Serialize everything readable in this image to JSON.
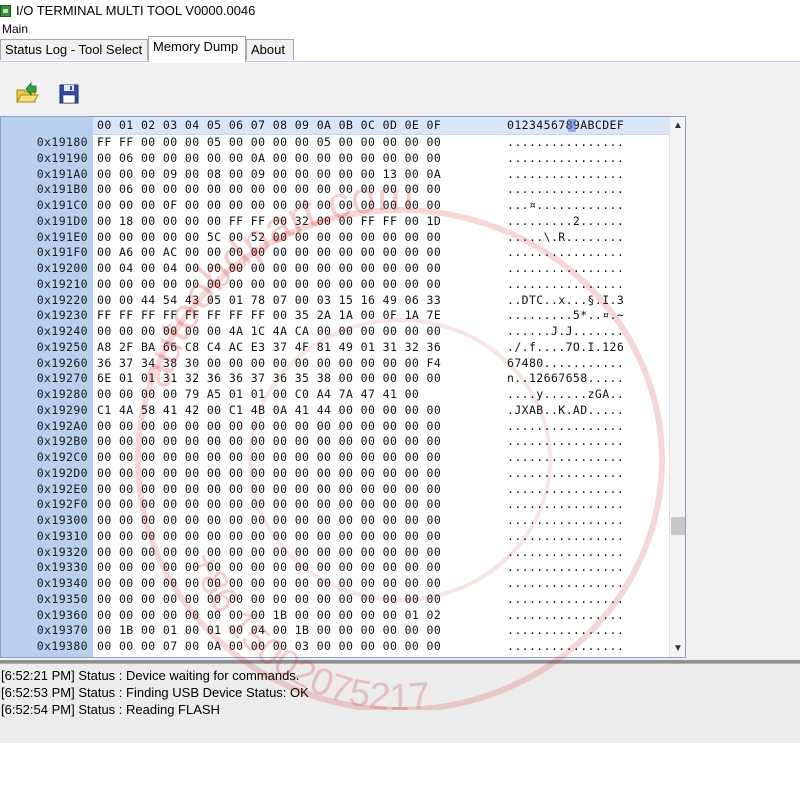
{
  "window": {
    "title": "I/O TERMINAL MULTI TOOL V0000.0046",
    "menu_main": "Main"
  },
  "tabs": [
    {
      "label": "Status Log - Tool Select",
      "active": false
    },
    {
      "label": "Memory Dump",
      "active": true
    },
    {
      "label": "About",
      "active": false
    }
  ],
  "toolbar": {
    "open_icon": "folder-open-icon",
    "save_icon": "floppy-save-icon"
  },
  "hex_view": {
    "header_hex": "00 01 02 03 04 05 06 07 08 09 0A 0B 0C 0D 0E 0F",
    "header_ascii": "0123456789ABCDEF",
    "rows": [
      {
        "offset": "0x19180",
        "hex": "FF FF 00 00 00 05 00 00 00 00 05 00 00 00 00 00",
        "ascii": "................"
      },
      {
        "offset": "0x19190",
        "hex": "00 06 00 00 00 00 00 0A 00 00 00 00 00 00 00 00",
        "ascii": "................"
      },
      {
        "offset": "0x191A0",
        "hex": "00 00 00 09 00 08 00 09 00 00 00 00 00 13 00 0A",
        "ascii": "................"
      },
      {
        "offset": "0x191B0",
        "hex": "00 06 00 00 00 00 00 00 00 00 00 00 00 00 00 00",
        "ascii": "................"
      },
      {
        "offset": "0x191C0",
        "hex": "00 00 00 0F 00 00 00 00 00 00 00 00 00 00 00 00",
        "ascii": "...¤............"
      },
      {
        "offset": "0x191D0",
        "hex": "00 18 00 00 00 00 FF FF 00 32 00 00 FF FF 00 1D",
        "ascii": ".........2......"
      },
      {
        "offset": "0x191E0",
        "hex": "00 00 00 00 00 5C 00 52 00 00 00 00 00 00 00 00",
        "ascii": ".....\\.R........"
      },
      {
        "offset": "0x191F0",
        "hex": "00 A6 00 AC 00 00 00 00 00 00 00 00 00 00 00 00",
        "ascii": "................"
      },
      {
        "offset": "0x19200",
        "hex": "00 04 00 04 00 00 00 00 00 00 00 00 00 00 00 00",
        "ascii": "................"
      },
      {
        "offset": "0x19210",
        "hex": "00 00 00 00 00 00 00 00 00 00 00 00 00 00 00 00",
        "ascii": "................"
      },
      {
        "offset": "0x19220",
        "hex": "00 00 44 54 43 05 01 78 07 00 03 15 16 49 06 33",
        "ascii": "..DTC..x...§.I.3"
      },
      {
        "offset": "0x19230",
        "hex": "FF FF FF FF FF FF FF FF 00 35 2A 1A 00 0F 1A 7E",
        "ascii": ".........5*..¤.~"
      },
      {
        "offset": "0x19240",
        "hex": "00 00 00 00 00 00 4A 1C 4A CA 00 00 00 00 00 00",
        "ascii": "......J.J......."
      },
      {
        "offset": "0x19250",
        "hex": "A8 2F BA 66 C8 C4 AC E3 37 4F 81 49 01 31 32 36",
        "ascii": "./.f....7O.I.126"
      },
      {
        "offset": "0x19260",
        "hex": "36 37 34 38 30 00 00 00 00 00 00 00 00 00 00 F4",
        "ascii": "67480..........."
      },
      {
        "offset": "0x19270",
        "hex": "6E 01 01 31 32 36 36 37 36 35 38 00 00 00 00 00",
        "ascii": "n..12667658....."
      },
      {
        "offset": "0x19280",
        "hex": "00 00 00 00 79 A5 01 01 00 C0 A4 7A 47 41 00",
        "ascii": "....y......zGA.."
      },
      {
        "offset": "0x19290",
        "hex": "C1 4A 58 41 42 00 C1 4B 0A 41 44 00 00 00 00 00",
        "ascii": ".JXAB..K.AD....."
      },
      {
        "offset": "0x192A0",
        "hex": "00 00 00 00 00 00 00 00 00 00 00 00 00 00 00 00",
        "ascii": "................"
      },
      {
        "offset": "0x192B0",
        "hex": "00 00 00 00 00 00 00 00 00 00 00 00 00 00 00 00",
        "ascii": "................"
      },
      {
        "offset": "0x192C0",
        "hex": "00 00 00 00 00 00 00 00 00 00 00 00 00 00 00 00",
        "ascii": "................"
      },
      {
        "offset": "0x192D0",
        "hex": "00 00 00 00 00 00 00 00 00 00 00 00 00 00 00 00",
        "ascii": "................"
      },
      {
        "offset": "0x192E0",
        "hex": "00 00 00 00 00 00 00 00 00 00 00 00 00 00 00 00",
        "ascii": "................"
      },
      {
        "offset": "0x192F0",
        "hex": "00 00 00 00 00 00 00 00 00 00 00 00 00 00 00 00",
        "ascii": "................"
      },
      {
        "offset": "0x19300",
        "hex": "00 00 00 00 00 00 00 00 00 00 00 00 00 00 00 00",
        "ascii": "................"
      },
      {
        "offset": "0x19310",
        "hex": "00 00 00 00 00 00 00 00 00 00 00 00 00 00 00 00",
        "ascii": "................"
      },
      {
        "offset": "0x19320",
        "hex": "00 00 00 00 00 00 00 00 00 00 00 00 00 00 00 00",
        "ascii": "................"
      },
      {
        "offset": "0x19330",
        "hex": "00 00 00 00 00 00 00 00 00 00 00 00 00 00 00 00",
        "ascii": "................"
      },
      {
        "offset": "0x19340",
        "hex": "00 00 00 00 00 00 00 00 00 00 00 00 00 00 00 00",
        "ascii": "................"
      },
      {
        "offset": "0x19350",
        "hex": "00 00 00 00 00 00 00 00 00 00 00 00 00 00 00 00",
        "ascii": "................"
      },
      {
        "offset": "0x19360",
        "hex": "00 00 00 00 00 00 00 00 1B 00 00 00 00 00 01 02",
        "ascii": "................"
      },
      {
        "offset": "0x19370",
        "hex": "00 1B 00 01 00 01 00 04 00 1B 00 00 00 00 00 00",
        "ascii": "................"
      },
      {
        "offset": "0x19380",
        "hex": "00 00 00 07 00 0A 00 00 00 03 00 00 00 00 00 00",
        "ascii": "................"
      }
    ]
  },
  "log": [
    "[6:52:21 PM] Status : Device waiting for commands.",
    "[6:52:53 PM] Status : Finding USB Device Status: OK",
    "[6:52:54 PM] Status : Reading FLASH"
  ],
  "watermark": {
    "top": "autoobdpart.com",
    "bottom": "+86 15002075217",
    "color": "#cc2222"
  }
}
